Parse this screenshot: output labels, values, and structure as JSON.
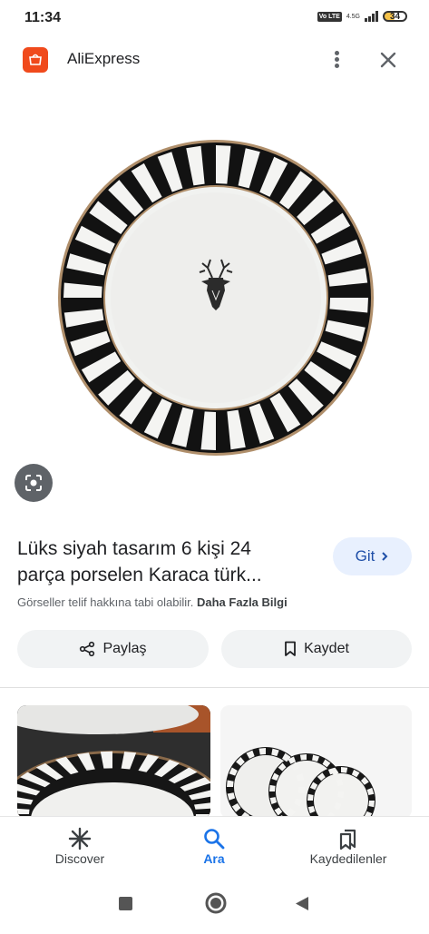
{
  "status_bar": {
    "time": "11:34",
    "volte": "Vo LTE",
    "network": "4.5G",
    "battery": "34"
  },
  "app": {
    "name": "AliExpress"
  },
  "product": {
    "title_line1": "Lüks siyah tasarım 6 kişi 24",
    "title_line2": "parça porselen Karaca türk...",
    "visit_label": "Git",
    "copyright_text": "Görseller telif hakkına tabi olabilir.",
    "more_info_label": "Daha Fazla Bilgi"
  },
  "actions": {
    "share_label": "Paylaş",
    "save_label": "Kaydet"
  },
  "bottom_nav": {
    "items": [
      {
        "label": "Discover",
        "icon": "asterisk-icon"
      },
      {
        "label": "Ara",
        "icon": "search-icon",
        "active": true
      },
      {
        "label": "Kaydedilenler",
        "icon": "bookmarks-icon"
      }
    ]
  },
  "colors": {
    "accent": "#1a73e8",
    "brand": "#f04a1c",
    "chip_bg": "#e8f0fe"
  }
}
